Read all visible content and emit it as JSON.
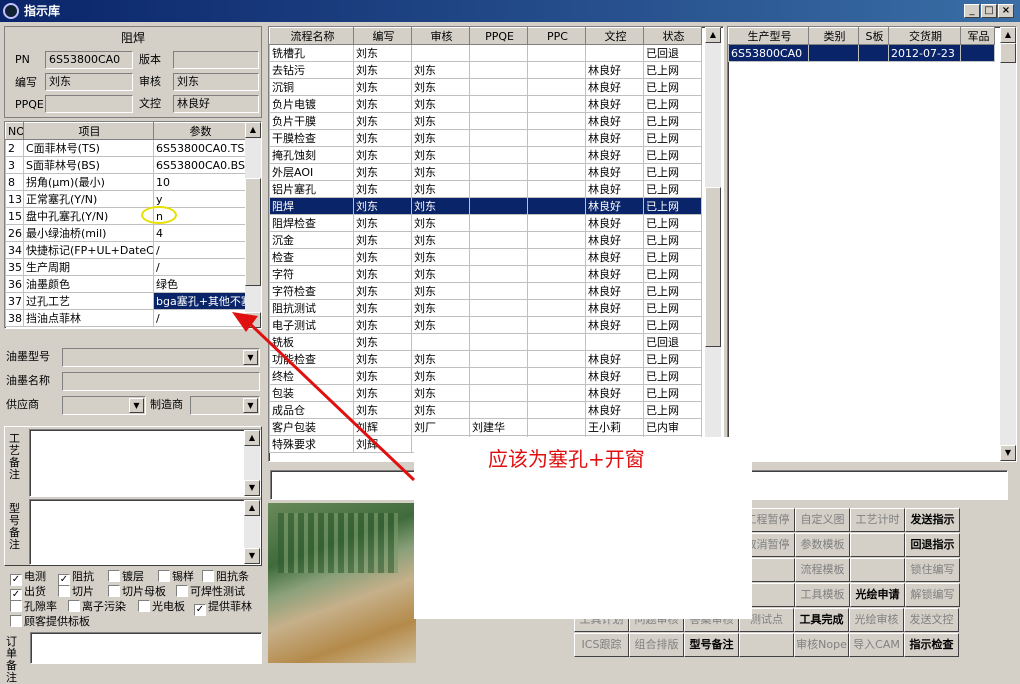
{
  "window": {
    "title": "指示库",
    "min": "_",
    "max": "□",
    "close": "×"
  },
  "process": {
    "name": "阻焊",
    "pn_label": "PN",
    "pn": "6S53800CA0",
    "version_label": "版本",
    "version": "",
    "writer_label": "编写",
    "writer": "刘东",
    "reviewer_label": "审核",
    "reviewer": "刘东",
    "ppqe_label": "PPQE",
    "ppqe": "",
    "doc_control_label": "文控",
    "doc_control": "林良好"
  },
  "params": {
    "headers": [
      "NO",
      "项目",
      "参数"
    ],
    "rows": [
      {
        "no": "2",
        "item": "C面菲林号(TS)",
        "val": "6S53800CA0.TS"
      },
      {
        "no": "3",
        "item": "S面菲林号(BS)",
        "val": "6S53800CA0.BS"
      },
      {
        "no": "8",
        "item": "拐角(μm)(最小)",
        "val": "10"
      },
      {
        "no": "13",
        "item": "正常塞孔(Y/N)",
        "val": "y"
      },
      {
        "no": "15",
        "item": "盘中孔塞孔(Y/N)",
        "val": "n"
      },
      {
        "no": "26",
        "item": "最小绿油桥(mil)",
        "val": "4"
      },
      {
        "no": "34",
        "item": "快捷标记(FP+UL+DateCo",
        "val": "/"
      },
      {
        "no": "35",
        "item": "生产周期",
        "val": "/"
      },
      {
        "no": "36",
        "item": "油墨颜色",
        "val": "绿色"
      },
      {
        "no": "37",
        "item": "过孔工艺",
        "val": "bga塞孔+其他不塞"
      },
      {
        "no": "38",
        "item": "挡油点菲林",
        "val": "/"
      }
    ]
  },
  "ink": {
    "type_label": "油墨型号",
    "type": "",
    "name_label": "油墨名称",
    "name": "",
    "supplier_label": "供应商",
    "supplier": "",
    "maker_label": "制造商",
    "maker": ""
  },
  "remarks": {
    "process_label": "工艺备注",
    "model_label": "型号备注",
    "order_label": "订单备注"
  },
  "checks": [
    {
      "label": "电测",
      "checked": true
    },
    {
      "label": "阻抗",
      "checked": true
    },
    {
      "label": "镀层",
      "checked": false
    },
    {
      "label": "锡样",
      "checked": false
    },
    {
      "label": "阻抗条",
      "checked": false
    },
    {
      "label": "出货",
      "checked": true
    },
    {
      "label": "切片",
      "checked": false
    },
    {
      "label": "切片母板",
      "checked": false
    },
    {
      "label": "可焊性测试",
      "checked": false
    },
    {
      "label": "孔隙率",
      "checked": false
    },
    {
      "label": "离子污染",
      "checked": false
    },
    {
      "label": "光电板",
      "checked": false
    },
    {
      "label": "提供菲林",
      "checked": true
    },
    {
      "label": "顾客提供标板",
      "checked": false
    }
  ],
  "flow": {
    "headers": [
      "流程名称",
      "编写",
      "审核",
      "PPQE",
      "PPC",
      "文控",
      "状态"
    ],
    "rows": [
      [
        "铣槽孔",
        "刘东",
        "",
        "",
        "",
        "",
        "已回退"
      ],
      [
        "去钻污",
        "刘东",
        "刘东",
        "",
        "",
        "林良好",
        "已上网"
      ],
      [
        "沉铜",
        "刘东",
        "刘东",
        "",
        "",
        "林良好",
        "已上网"
      ],
      [
        "负片电镀",
        "刘东",
        "刘东",
        "",
        "",
        "林良好",
        "已上网"
      ],
      [
        "负片干膜",
        "刘东",
        "刘东",
        "",
        "",
        "林良好",
        "已上网"
      ],
      [
        "干膜检查",
        "刘东",
        "刘东",
        "",
        "",
        "林良好",
        "已上网"
      ],
      [
        "掩孔蚀刻",
        "刘东",
        "刘东",
        "",
        "",
        "林良好",
        "已上网"
      ],
      [
        "外层AOI",
        "刘东",
        "刘东",
        "",
        "",
        "林良好",
        "已上网"
      ],
      [
        "铝片塞孔",
        "刘东",
        "刘东",
        "",
        "",
        "林良好",
        "已上网"
      ],
      [
        "阻焊",
        "刘东",
        "刘东",
        "",
        "",
        "林良好",
        "已上网"
      ],
      [
        "阻焊检查",
        "刘东",
        "刘东",
        "",
        "",
        "林良好",
        "已上网"
      ],
      [
        "沉金",
        "刘东",
        "刘东",
        "",
        "",
        "林良好",
        "已上网"
      ],
      [
        "检查",
        "刘东",
        "刘东",
        "",
        "",
        "林良好",
        "已上网"
      ],
      [
        "字符",
        "刘东",
        "刘东",
        "",
        "",
        "林良好",
        "已上网"
      ],
      [
        "字符检查",
        "刘东",
        "刘东",
        "",
        "",
        "林良好",
        "已上网"
      ],
      [
        "阻抗测试",
        "刘东",
        "刘东",
        "",
        "",
        "林良好",
        "已上网"
      ],
      [
        "电子测试",
        "刘东",
        "刘东",
        "",
        "",
        "林良好",
        "已上网"
      ],
      [
        "铣板",
        "刘东",
        "",
        "",
        "",
        "",
        "已回退"
      ],
      [
        "功能检查",
        "刘东",
        "刘东",
        "",
        "",
        "林良好",
        "已上网"
      ],
      [
        "终检",
        "刘东",
        "刘东",
        "",
        "",
        "林良好",
        "已上网"
      ],
      [
        "包装",
        "刘东",
        "刘东",
        "",
        "",
        "林良好",
        "已上网"
      ],
      [
        "成品仓",
        "刘东",
        "刘东",
        "",
        "",
        "林良好",
        "已上网"
      ],
      [
        "客户包装",
        "刘辉",
        "刘厂",
        "刘建华",
        "",
        "王小莉",
        "已内审"
      ],
      [
        "特殊要求",
        "刘辉",
        "",
        "",
        "",
        "",
        ""
      ]
    ],
    "selected": 9
  },
  "order": {
    "headers": [
      "生产型号",
      "类别",
      "S板",
      "交货期",
      "军品"
    ],
    "rows": [
      [
        "6S53800CA0",
        "",
        "",
        "2012-07-23",
        ""
      ]
    ]
  },
  "annotation": {
    "text": "应该为塞孔+开窗",
    "color": "#e01010"
  },
  "buttons": [
    [
      "",
      "价条件",
      "工程暂停",
      "自定义图",
      "工艺计时",
      "发送指示"
    ],
    [
      "",
      "拼条件",
      "取消暂停",
      "参数模板",
      "",
      "回退指示"
    ],
    [
      "",
      "略拼板",
      "",
      "流程模板",
      "",
      "锁住编写"
    ],
    [
      "",
      "厂警告",
      "",
      "工具模板",
      "光绘申请",
      "解锁编写"
    ],
    [
      "工具计划",
      "问题审核",
      "答案审核",
      "测试点",
      "工具完成",
      "光绘审核",
      "发送文控"
    ],
    [
      "ICS跟踪",
      "组合排版",
      "型号备注",
      "",
      "审核Nope",
      "导入CAM",
      "指示检查"
    ]
  ]
}
